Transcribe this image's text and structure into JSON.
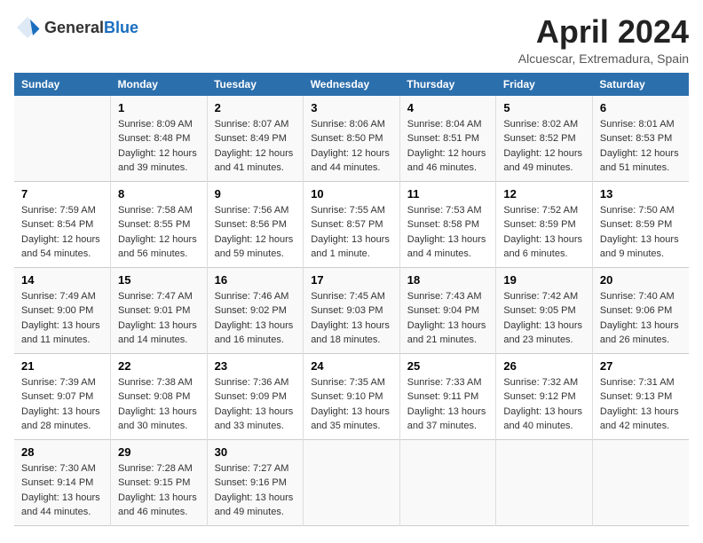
{
  "header": {
    "logo_general": "General",
    "logo_blue": "Blue",
    "month_title": "April 2024",
    "subtitle": "Alcuescar, Extremadura, Spain"
  },
  "days_of_week": [
    "Sunday",
    "Monday",
    "Tuesday",
    "Wednesday",
    "Thursday",
    "Friday",
    "Saturday"
  ],
  "weeks": [
    [
      {
        "day": "",
        "sunrise": "",
        "sunset": "",
        "daylight": ""
      },
      {
        "day": "1",
        "sunrise": "Sunrise: 8:09 AM",
        "sunset": "Sunset: 8:48 PM",
        "daylight": "Daylight: 12 hours and 39 minutes."
      },
      {
        "day": "2",
        "sunrise": "Sunrise: 8:07 AM",
        "sunset": "Sunset: 8:49 PM",
        "daylight": "Daylight: 12 hours and 41 minutes."
      },
      {
        "day": "3",
        "sunrise": "Sunrise: 8:06 AM",
        "sunset": "Sunset: 8:50 PM",
        "daylight": "Daylight: 12 hours and 44 minutes."
      },
      {
        "day": "4",
        "sunrise": "Sunrise: 8:04 AM",
        "sunset": "Sunset: 8:51 PM",
        "daylight": "Daylight: 12 hours and 46 minutes."
      },
      {
        "day": "5",
        "sunrise": "Sunrise: 8:02 AM",
        "sunset": "Sunset: 8:52 PM",
        "daylight": "Daylight: 12 hours and 49 minutes."
      },
      {
        "day": "6",
        "sunrise": "Sunrise: 8:01 AM",
        "sunset": "Sunset: 8:53 PM",
        "daylight": "Daylight: 12 hours and 51 minutes."
      }
    ],
    [
      {
        "day": "7",
        "sunrise": "Sunrise: 7:59 AM",
        "sunset": "Sunset: 8:54 PM",
        "daylight": "Daylight: 12 hours and 54 minutes."
      },
      {
        "day": "8",
        "sunrise": "Sunrise: 7:58 AM",
        "sunset": "Sunset: 8:55 PM",
        "daylight": "Daylight: 12 hours and 56 minutes."
      },
      {
        "day": "9",
        "sunrise": "Sunrise: 7:56 AM",
        "sunset": "Sunset: 8:56 PM",
        "daylight": "Daylight: 12 hours and 59 minutes."
      },
      {
        "day": "10",
        "sunrise": "Sunrise: 7:55 AM",
        "sunset": "Sunset: 8:57 PM",
        "daylight": "Daylight: 13 hours and 1 minute."
      },
      {
        "day": "11",
        "sunrise": "Sunrise: 7:53 AM",
        "sunset": "Sunset: 8:58 PM",
        "daylight": "Daylight: 13 hours and 4 minutes."
      },
      {
        "day": "12",
        "sunrise": "Sunrise: 7:52 AM",
        "sunset": "Sunset: 8:59 PM",
        "daylight": "Daylight: 13 hours and 6 minutes."
      },
      {
        "day": "13",
        "sunrise": "Sunrise: 7:50 AM",
        "sunset": "Sunset: 8:59 PM",
        "daylight": "Daylight: 13 hours and 9 minutes."
      }
    ],
    [
      {
        "day": "14",
        "sunrise": "Sunrise: 7:49 AM",
        "sunset": "Sunset: 9:00 PM",
        "daylight": "Daylight: 13 hours and 11 minutes."
      },
      {
        "day": "15",
        "sunrise": "Sunrise: 7:47 AM",
        "sunset": "Sunset: 9:01 PM",
        "daylight": "Daylight: 13 hours and 14 minutes."
      },
      {
        "day": "16",
        "sunrise": "Sunrise: 7:46 AM",
        "sunset": "Sunset: 9:02 PM",
        "daylight": "Daylight: 13 hours and 16 minutes."
      },
      {
        "day": "17",
        "sunrise": "Sunrise: 7:45 AM",
        "sunset": "Sunset: 9:03 PM",
        "daylight": "Daylight: 13 hours and 18 minutes."
      },
      {
        "day": "18",
        "sunrise": "Sunrise: 7:43 AM",
        "sunset": "Sunset: 9:04 PM",
        "daylight": "Daylight: 13 hours and 21 minutes."
      },
      {
        "day": "19",
        "sunrise": "Sunrise: 7:42 AM",
        "sunset": "Sunset: 9:05 PM",
        "daylight": "Daylight: 13 hours and 23 minutes."
      },
      {
        "day": "20",
        "sunrise": "Sunrise: 7:40 AM",
        "sunset": "Sunset: 9:06 PM",
        "daylight": "Daylight: 13 hours and 26 minutes."
      }
    ],
    [
      {
        "day": "21",
        "sunrise": "Sunrise: 7:39 AM",
        "sunset": "Sunset: 9:07 PM",
        "daylight": "Daylight: 13 hours and 28 minutes."
      },
      {
        "day": "22",
        "sunrise": "Sunrise: 7:38 AM",
        "sunset": "Sunset: 9:08 PM",
        "daylight": "Daylight: 13 hours and 30 minutes."
      },
      {
        "day": "23",
        "sunrise": "Sunrise: 7:36 AM",
        "sunset": "Sunset: 9:09 PM",
        "daylight": "Daylight: 13 hours and 33 minutes."
      },
      {
        "day": "24",
        "sunrise": "Sunrise: 7:35 AM",
        "sunset": "Sunset: 9:10 PM",
        "daylight": "Daylight: 13 hours and 35 minutes."
      },
      {
        "day": "25",
        "sunrise": "Sunrise: 7:33 AM",
        "sunset": "Sunset: 9:11 PM",
        "daylight": "Daylight: 13 hours and 37 minutes."
      },
      {
        "day": "26",
        "sunrise": "Sunrise: 7:32 AM",
        "sunset": "Sunset: 9:12 PM",
        "daylight": "Daylight: 13 hours and 40 minutes."
      },
      {
        "day": "27",
        "sunrise": "Sunrise: 7:31 AM",
        "sunset": "Sunset: 9:13 PM",
        "daylight": "Daylight: 13 hours and 42 minutes."
      }
    ],
    [
      {
        "day": "28",
        "sunrise": "Sunrise: 7:30 AM",
        "sunset": "Sunset: 9:14 PM",
        "daylight": "Daylight: 13 hours and 44 minutes."
      },
      {
        "day": "29",
        "sunrise": "Sunrise: 7:28 AM",
        "sunset": "Sunset: 9:15 PM",
        "daylight": "Daylight: 13 hours and 46 minutes."
      },
      {
        "day": "30",
        "sunrise": "Sunrise: 7:27 AM",
        "sunset": "Sunset: 9:16 PM",
        "daylight": "Daylight: 13 hours and 49 minutes."
      },
      {
        "day": "",
        "sunrise": "",
        "sunset": "",
        "daylight": ""
      },
      {
        "day": "",
        "sunrise": "",
        "sunset": "",
        "daylight": ""
      },
      {
        "day": "",
        "sunrise": "",
        "sunset": "",
        "daylight": ""
      },
      {
        "day": "",
        "sunrise": "",
        "sunset": "",
        "daylight": ""
      }
    ]
  ]
}
